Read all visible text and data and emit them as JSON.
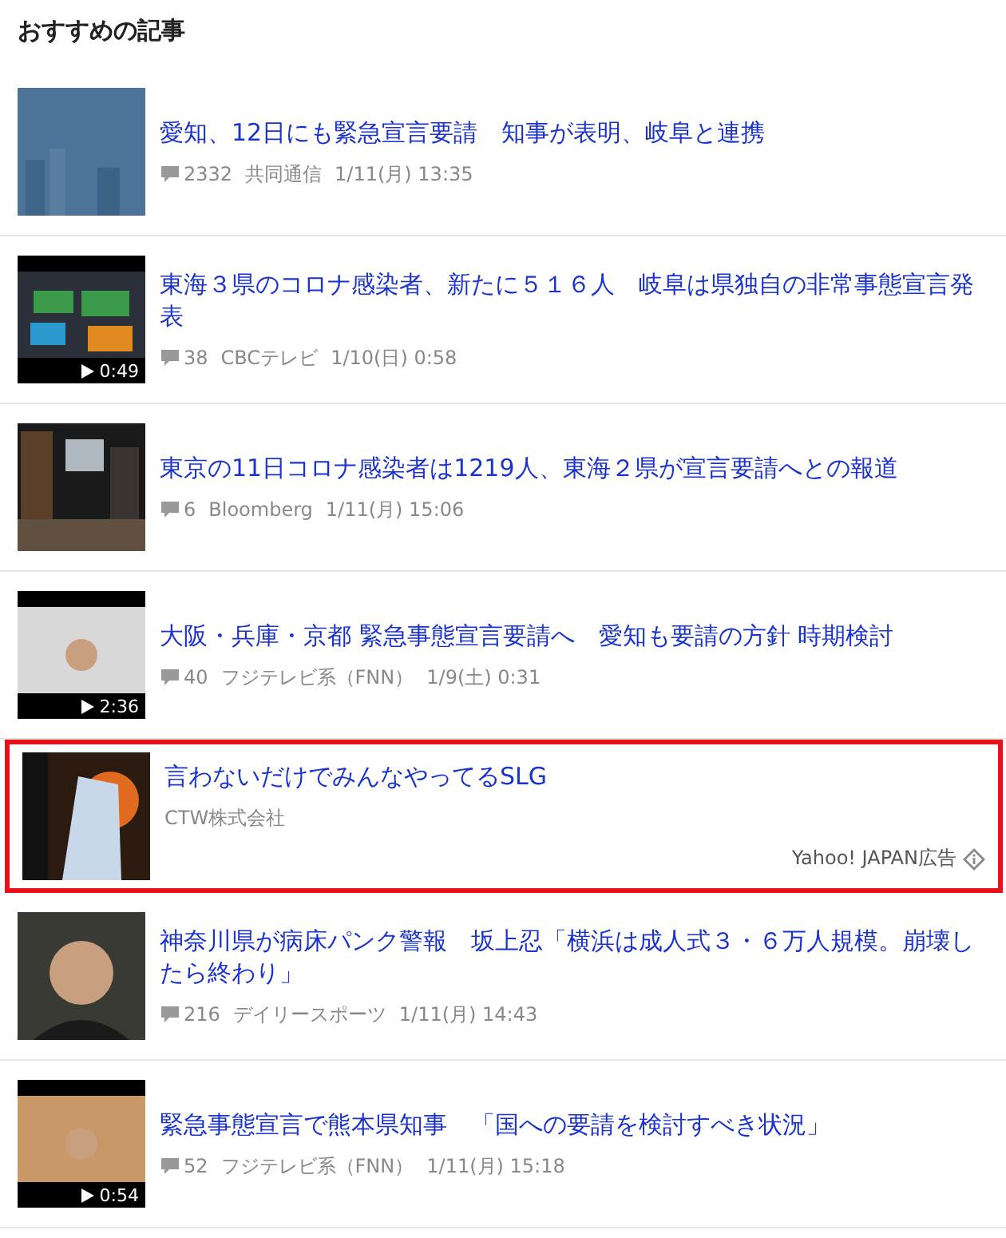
{
  "heading": "おすすめの記事",
  "items": [
    {
      "kind": "news",
      "highlighted": false,
      "title": "愛知、12日にも緊急宣言要請　知事が表明、岐阜と連携",
      "comments": "2332",
      "source": "共同通信",
      "date": "1/11(月) 13:35"
    },
    {
      "kind": "news",
      "highlighted": false,
      "title": "東海３県のコロナ感染者、新たに５１６人　岐阜は県独自の非常事態宣言発表",
      "comments": "38",
      "source": "CBCテレビ",
      "date": "1/10(日) 0:58",
      "duration": "0:49"
    },
    {
      "kind": "news",
      "highlighted": false,
      "title": "東京の11日コロナ感染者は1219人、東海２県が宣言要請へとの報道",
      "comments": "6",
      "source": "Bloomberg",
      "date": "1/11(月) 15:06"
    },
    {
      "kind": "news",
      "highlighted": false,
      "title": "大阪・兵庫・京都 緊急事態宣言要請へ　愛知も要請の方針 時期検討",
      "comments": "40",
      "source": "フジテレビ系（FNN）",
      "date": "1/9(土) 0:31",
      "duration": "2:36"
    },
    {
      "kind": "ad",
      "highlighted": true,
      "title": "言わないだけでみんなやってるSLG",
      "advertiser": "CTW株式会社",
      "ad_label": "Yahoo! JAPAN広告"
    },
    {
      "kind": "news",
      "highlighted": false,
      "title": "神奈川県が病床パンク警報　坂上忍「横浜は成人式３・６万人規模。崩壊したら終わり」",
      "comments": "216",
      "source": "デイリースポーツ",
      "date": "1/11(月) 14:43"
    },
    {
      "kind": "news",
      "highlighted": false,
      "title": "緊急事態宣言で熊本県知事　「国への要請を検討すべき状況」",
      "comments": "52",
      "source": "フジテレビ系（FNN）",
      "date": "1/11(月) 15:18",
      "duration": "0:54"
    }
  ]
}
